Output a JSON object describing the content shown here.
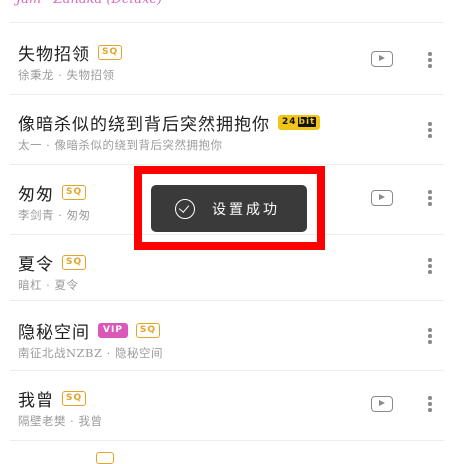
{
  "header_partial": "Jam · Zanaka (Deluxe)",
  "songs": [
    {
      "title": "失物招领",
      "badges": [
        "SQ"
      ],
      "subtitle": "徐秉龙 · 失物招领",
      "has_video": true
    },
    {
      "title": "像暗杀似的绕到背后突然拥抱你",
      "badges": [
        "24bit"
      ],
      "subtitle": "太一 · 像暗杀似的绕到背后突然拥抱你",
      "has_video": false
    },
    {
      "title": "匆匆",
      "badges": [
        "SQ"
      ],
      "subtitle": "李剑青 · 匆匆",
      "has_video": true
    },
    {
      "title": "夏令",
      "badges": [
        "SQ"
      ],
      "subtitle": "暗杠 · 夏令",
      "has_video": false
    },
    {
      "title": "隐秘空间",
      "badges": [
        "VIP",
        "SQ"
      ],
      "subtitle": "南征北战NZBZ · 隐秘空间",
      "has_video": false
    },
    {
      "title": "我曾",
      "badges": [
        "SQ"
      ],
      "subtitle": "隔壁老樊 · 我曾",
      "has_video": true
    }
  ],
  "toast": {
    "message": "设置成功",
    "icon": "check-circle-icon"
  },
  "icons": {
    "video": "video-play-icon",
    "more": "more-vertical-icon"
  },
  "colors": {
    "sq_badge": "#e3a529",
    "vip_badge": "#d958b8",
    "bit_badge": "#f0c419",
    "toast_bg": "#3a3a3a",
    "highlight": "#ff0000"
  }
}
